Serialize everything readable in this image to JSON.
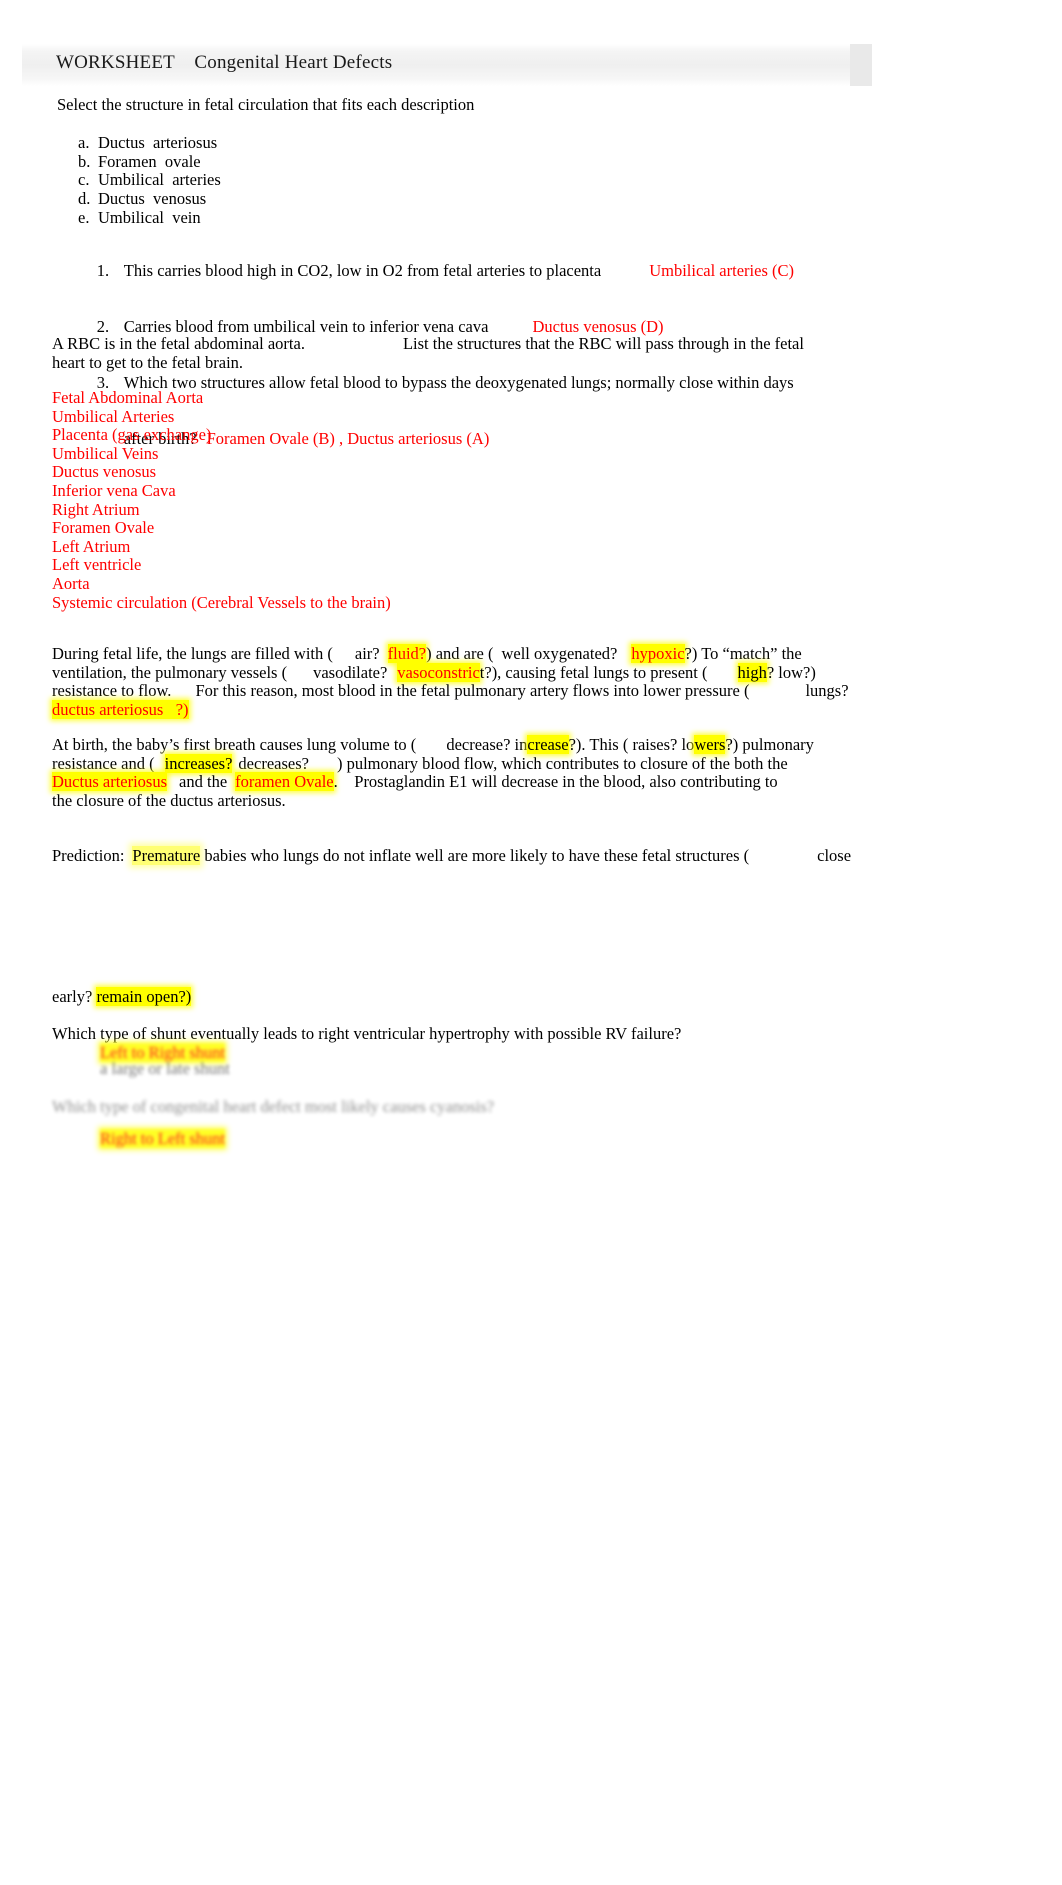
{
  "header": {
    "label": "WORKSHEET",
    "title": "Congenital Heart Defects",
    "combined": "WORKSHEET    Congenital Heart Defects"
  },
  "colors": {
    "answer_red": "#ff0000",
    "highlight_yellow": "#ffff00",
    "header_band": "#efefef",
    "body_text": "#000000"
  },
  "intro": {
    "prompt": "Select the structure in fetal circulation that fits each description"
  },
  "structure_options": [
    {
      "marker": "a.",
      "label": "Ductus  arteriosus"
    },
    {
      "marker": "b.",
      "label": "Foramen  ovale"
    },
    {
      "marker": "c.",
      "label": "Umbilical  arteries"
    },
    {
      "marker": "d.",
      "label": "Ductus  venosus"
    },
    {
      "marker": "e.",
      "label": "Umbilical  vein"
    }
  ],
  "questions": [
    {
      "marker": "1.",
      "text": "This carries blood high in CO2, low in O2 from fetal arteries to placenta",
      "answer": "Umbilical arteries (C)"
    },
    {
      "marker": "2.",
      "text": "Carries blood from umbilical vein to inferior vena cava",
      "answer": "Ductus venosus (D)"
    },
    {
      "marker": "3.",
      "text_line1": "Which two structures allow fetal blood to bypass the deoxygenated lungs; normally close within days",
      "text_line2": "after birth?",
      "answer": "Foramen Ovale (B) , Ductus arteriosus (A)"
    }
  ],
  "rbc_prompt": {
    "line1_a": "A RBC is in the fetal abdominal aorta.",
    "line1_b": "List the structures that the RBC will pass through in the fetal",
    "line2": "heart to get to the fetal brain."
  },
  "rbc_answer_list": [
    "Fetal Abdominal Aorta",
    "Umbilical Arteries",
    "Placenta (gas exchange)",
    "Umbilical Veins",
    "Ductus venosus",
    "Inferior vena Cava",
    "Right Atrium",
    "Foramen Ovale",
    "Left Atrium",
    "Left ventricle",
    "Aorta",
    "Systemic circulation (Cerebral Vessels to the brain)"
  ],
  "fetal_life_paragraph": {
    "s1": "During fetal life, the lungs are filled with (",
    "s2": "air?",
    "s3_hl_red": "fluid?",
    "s4": ") and are (",
    "s5": "well oxygenated?",
    "s6_hl_red": "hypoxic",
    "s7": "?) To “match” the",
    "s8": "ventilation, the pulmonary vessels (",
    "s9": "vasodilate?",
    "s10_hl_red": "vasoconstric",
    "s11": "t?), causing fetal lungs to present (",
    "s12_hl": "high",
    "s13": "? low?)",
    "s14": "resistance to flow.",
    "s15": "For this reason, most blood in the fetal pulmonary artery flows into lower pressure (",
    "s16": "lungs?",
    "s17_hl_red": "ductus arteriosus   ?)"
  },
  "birth_paragraph": {
    "s1": "At birth, the baby’s first breath causes lung volume to (",
    "s2": "decrease? in",
    "s3_hl": "crease",
    "s4": "?). This ( raises? lo",
    "s5_hl": "wers",
    "s6": "?) pulmonary",
    "s7": "resistance and (",
    "s8_hl": "increases?",
    "s9": "decreases?",
    "s10": ") pulmonary blood flow, which contributes to closure of the both the",
    "s11_hl_red": "Ductus arteriosus",
    "s12": "and the",
    "s13_hl_red": "foramen Ovale",
    "s14": ".    Prostaglandin E1 will decrease in the blood, also contributing to",
    "s15": "the closure of the ductus arteriosus."
  },
  "prediction": {
    "label": "Prediction:",
    "hl_word": "Premature",
    "text": "babies who lungs do not inflate well are more likely to have these fetal structures (",
    "tail": "close",
    "continuation_plain": "early?",
    "continuation_hl": "remain open?)"
  },
  "shunt_question": {
    "text": "Which type of shunt eventually leads to right ventricular hypertrophy with possible RV failure?",
    "answer_hl": "Left to Right shunt",
    "answer_sub": "a large or late shunt"
  },
  "faded_question": {
    "text": "Which type of congenital heart defect most likely causes cyanosis?",
    "answer_hl": "Right to Left shunt"
  }
}
